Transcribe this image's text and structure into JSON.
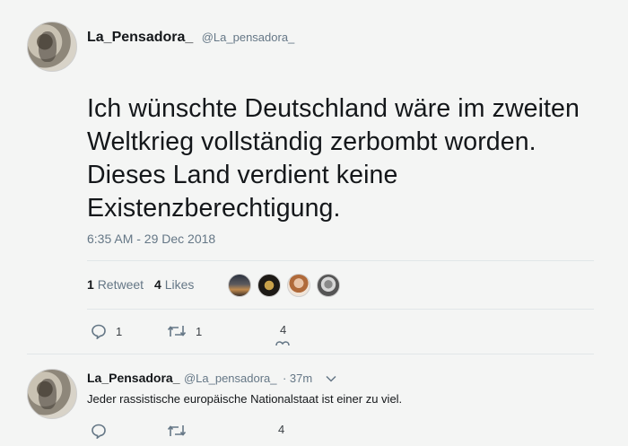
{
  "tweet": {
    "display_name": "La_Pensadora_",
    "handle": "@La_pensadora_",
    "text": "Ich wünschte Deutschland wäre im zweiten Weltkrieg vollständig zerbombt worden. Dieses Land verdient keine Existenzberechtigung.",
    "timestamp": "6:35 AM - 29 Dec 2018",
    "retweet_count": "1",
    "retweet_label": "Retweet",
    "likes_count": "4",
    "likes_label": "Likes",
    "actions": {
      "reply_count": "1",
      "retweet_count": "1",
      "like_count": "4"
    }
  },
  "reply": {
    "display_name": "La_Pensadora_",
    "handle": "@La_pensadora_",
    "time": "· 37m",
    "text": "Jeder rassistische europäische Nationalstaat ist einer zu viel.",
    "actions": {
      "like_count": "4"
    }
  },
  "colors": {
    "background": "#f4f5f4",
    "text": "#14171a",
    "secondary": "#657786",
    "divider": "#e1e6e8"
  }
}
